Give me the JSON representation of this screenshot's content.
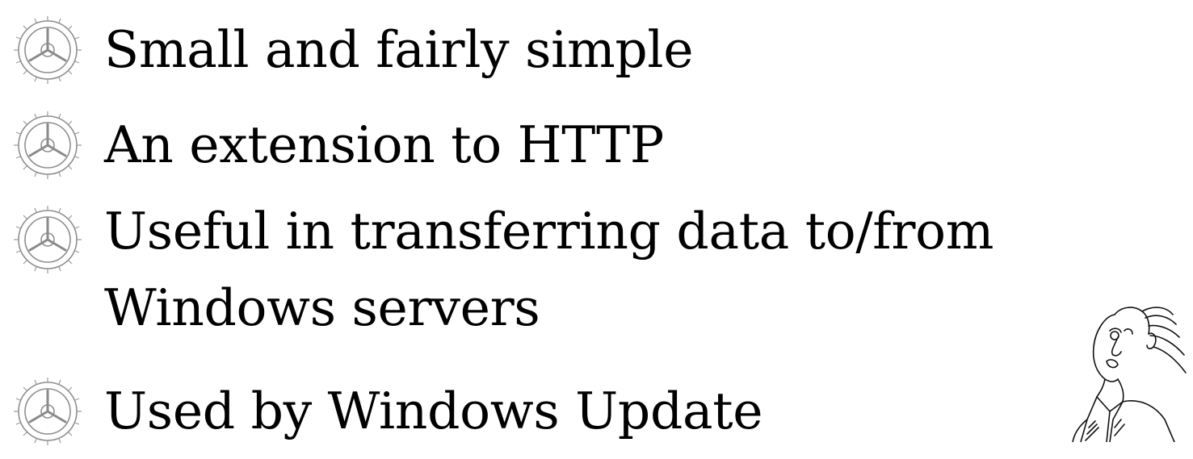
{
  "slide": {
    "bullets": [
      {
        "text": "Small and fairly simple",
        "icon": "gear-icon"
      },
      {
        "text": "An extension to HTTP",
        "icon": "gear-icon"
      },
      {
        "text": "Useful in transferring data to/from Windows servers",
        "icon": "gear-icon"
      },
      {
        "text": "Used by Windows Update",
        "icon": "gear-icon"
      }
    ],
    "illustration": "caricature-man-sketch",
    "colors": {
      "text": "#000000",
      "icon": "#9a9a9a",
      "background": "#ffffff"
    }
  }
}
